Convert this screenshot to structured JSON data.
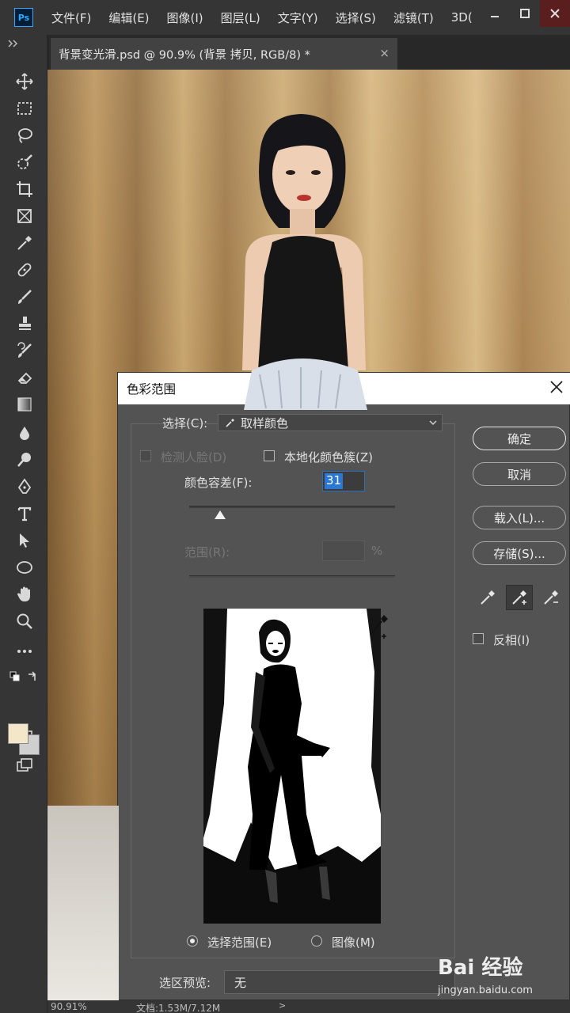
{
  "app": {
    "logo": "Ps",
    "menus": [
      "文件(F)",
      "编辑(E)",
      "图像(I)",
      "图层(L)",
      "文字(Y)",
      "选择(S)",
      "滤镜(T)",
      "3D("
    ]
  },
  "document": {
    "tab_label": "背景变光滑.psd @ 90.9% (背景 拷贝, RGB/8) *",
    "close": "×"
  },
  "status": {
    "zoom": "90.91%",
    "doc_info": "文档:1.53M/7.12M",
    "arrow": ">"
  },
  "dialog": {
    "title": "色彩范围",
    "select_label": "选择(C):",
    "select_value": "取样颜色",
    "detect_faces": "检测人脸(D)",
    "localized_clusters": "本地化颜色簇(Z)",
    "fuzziness_label": "颜色容差(F):",
    "fuzziness_value": "31",
    "fuzziness_fraction": 0.15,
    "range_label": "范围(R):",
    "range_unit": "%",
    "view_selection": "选择范围(E)",
    "view_image": "图像(M)",
    "selection_preview_label": "选区预览:",
    "selection_preview_value": "无",
    "buttons": {
      "ok": "确定",
      "cancel": "取消",
      "load": "载入(L)...",
      "save": "存储(S)..."
    },
    "invert": "反相(I)"
  },
  "watermark": {
    "logo": "Bai 经验",
    "url": "jingyan.baidu.com"
  },
  "colors": {
    "accent": "#2a78d4",
    "chrome": "#353535",
    "dialog_bg": "#535353"
  }
}
